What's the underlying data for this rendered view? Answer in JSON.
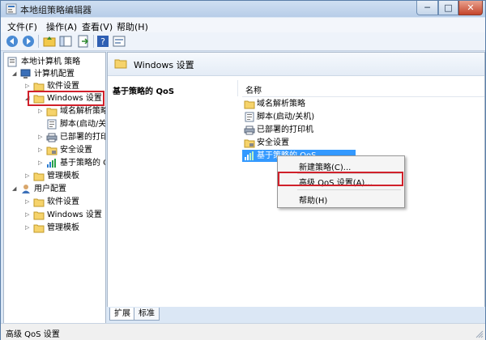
{
  "window": {
    "title": "本地组策略编辑器",
    "min_label": "─",
    "max_label": "□",
    "close_label": "✕"
  },
  "menu": [
    {
      "label": "文件(F)"
    },
    {
      "label": "操作(A)"
    },
    {
      "label": "查看(V)"
    },
    {
      "label": "帮助(H)"
    }
  ],
  "toolbar": {
    "icons": [
      "back-icon",
      "forward-icon",
      "up-folder-icon",
      "show-hide-tree-icon",
      "export-list-icon",
      "help-icon",
      "properties-icon"
    ]
  },
  "tree": {
    "root": "本地计算机 策略",
    "computer_config": "计算机配置",
    "software_settings": "软件设置",
    "windows_settings": "Windows 设置",
    "dns_policy": "域名解析策略",
    "scripts": "脚本(启动/关",
    "deployed_printers": "已部署的打印",
    "security_settings": "安全设置",
    "qos_policy": "基于策略的 Q",
    "admin_templates": "管理模板",
    "user_config": "用户配置",
    "user_software_settings": "软件设置",
    "user_windows_settings": "Windows 设置",
    "user_admin_templates": "管理模板"
  },
  "right_pane": {
    "header_title": "Windows 设置",
    "description_title": "基于策略的 QoS",
    "column_name": "名称",
    "items": [
      {
        "label": "域名解析策略",
        "icon": "folder-icon"
      },
      {
        "label": "脚本(启动/关机)",
        "icon": "script-icon"
      },
      {
        "label": "已部署的打印机",
        "icon": "printer-icon"
      },
      {
        "label": "安全设置",
        "icon": "security-icon"
      },
      {
        "label": "基于策略的 QoS",
        "icon": "qos-chart-icon"
      }
    ]
  },
  "context_menu": {
    "new_policy": "新建策略(C)...",
    "advanced_qos": "高级 QoS 设置(A)...",
    "help": "帮助(H)"
  },
  "tabs": [
    {
      "label": "扩展"
    },
    {
      "label": "标准"
    }
  ],
  "status": {
    "text": "高级 QoS 设置"
  },
  "colors": {
    "highlight_box": "#d0202a",
    "selection": "#3399ff",
    "title_gradient": "#b7cde8"
  }
}
